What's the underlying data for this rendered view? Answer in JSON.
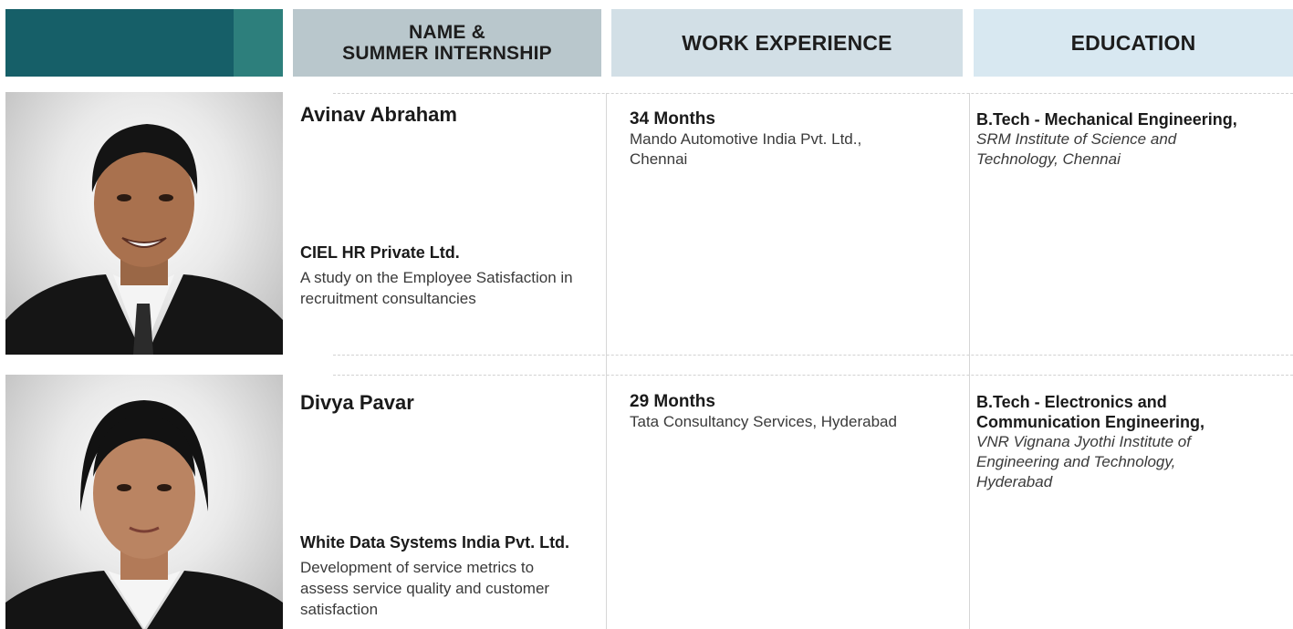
{
  "header": {
    "name_col_line1": "NAME &",
    "name_col_line2": "SUMMER INTERNSHIP",
    "work_col": "WORK EXPERIENCE",
    "edu_col": "EDUCATION"
  },
  "colors": {
    "header_dark_teal": "#165f68",
    "header_light_teal": "#2d7f7c",
    "header_name_bg": "#b9c7cc",
    "header_work_bg": "#d2dfe6",
    "header_edu_bg": "#d8e8f1"
  },
  "students": [
    {
      "name": "Avinav Abraham",
      "internship_org": "CIEL HR Private Ltd.",
      "internship_project": "A study on the Employee Satisfaction in recruitment consultancies",
      "experience_duration": "34 Months",
      "experience_company": "Mando Automotive India Pvt. Ltd., Chennai",
      "degree": "B.Tech - Mechanical Engineering,",
      "institute": "SRM Institute of Science and Technology, Chennai"
    },
    {
      "name": "Divya Pavar",
      "internship_org": "White Data Systems India Pvt. Ltd.",
      "internship_project": "Development of service metrics to assess service quality and customer satisfaction",
      "experience_duration": "29 Months",
      "experience_company": "Tata Consultancy Services, Hyderabad",
      "degree": "B.Tech - Electronics and Communication Engineering,",
      "institute": "VNR Vignana Jyothi Institute of Engineering and Technology, Hyderabad"
    }
  ]
}
